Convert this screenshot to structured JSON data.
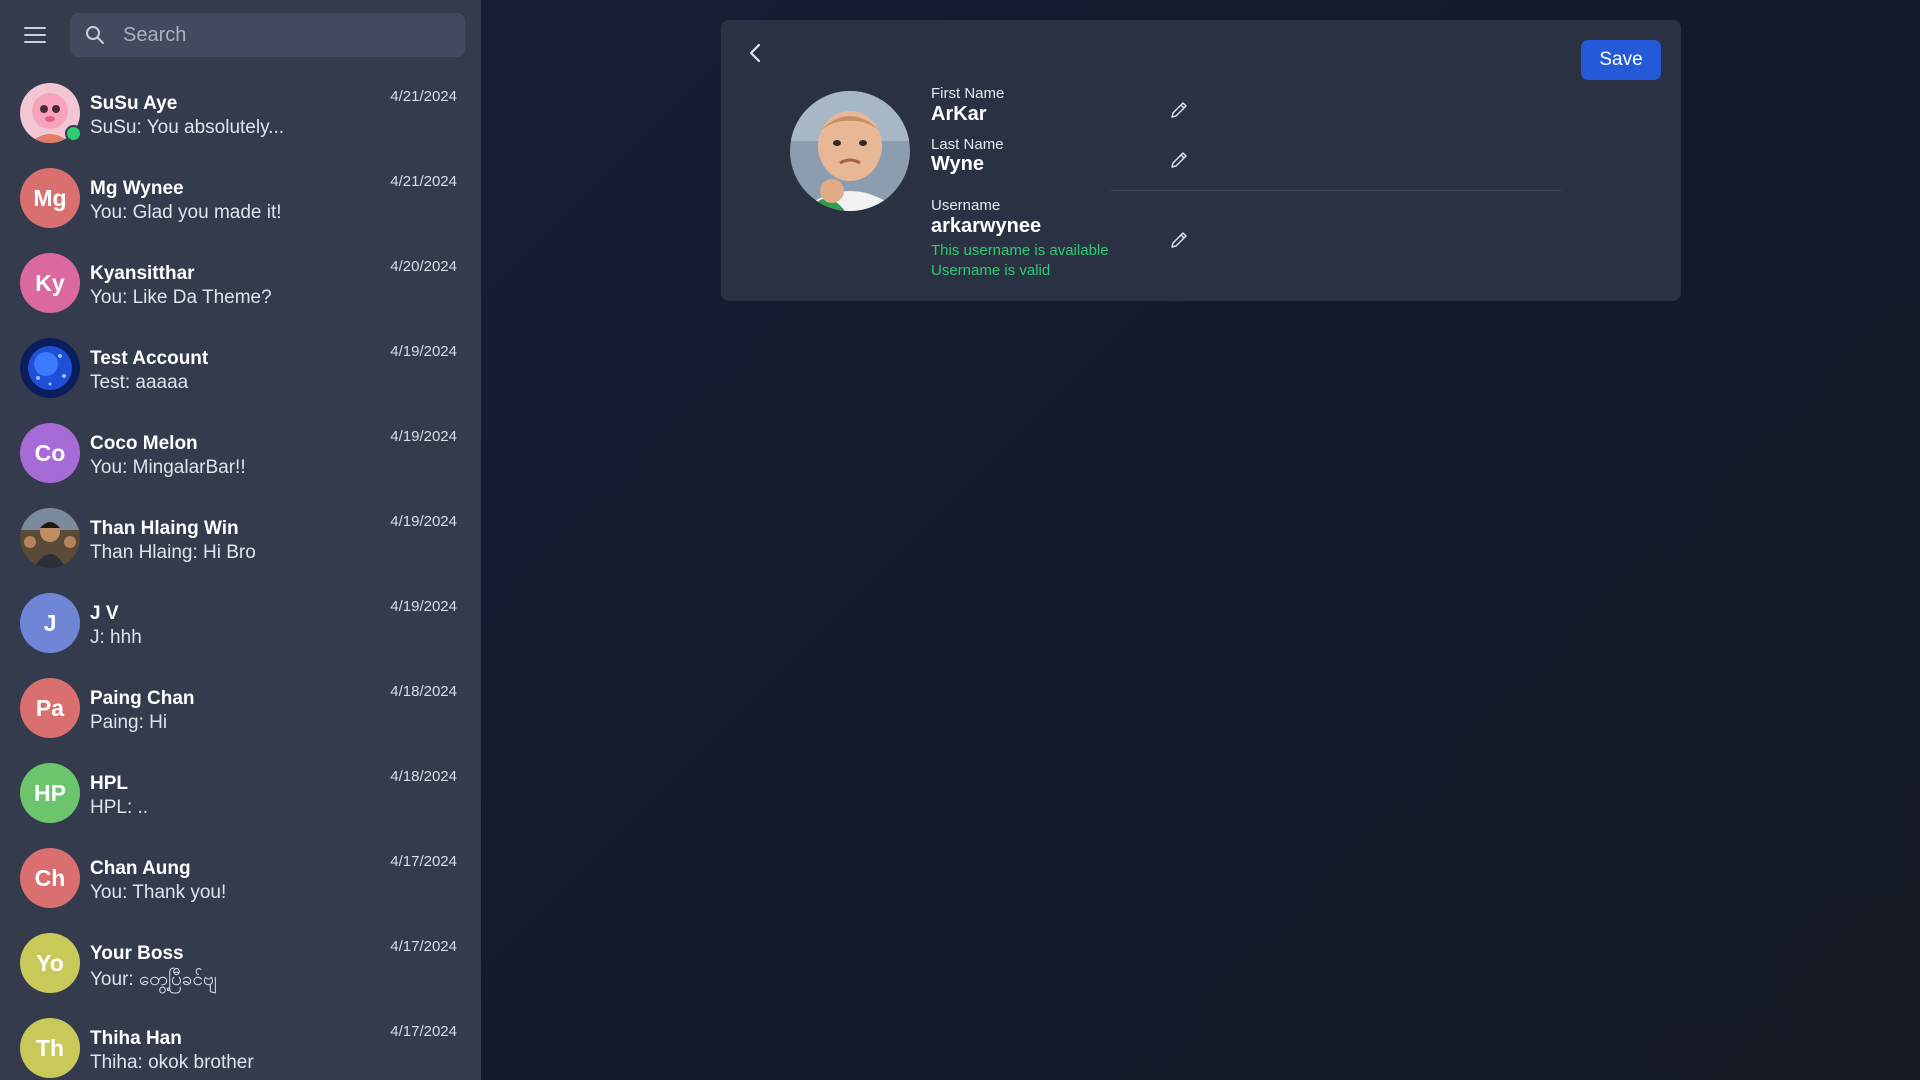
{
  "search": {
    "placeholder": "Search"
  },
  "chats": [
    {
      "name": "SuSu Aye",
      "message": "SuSu: You absolutely...",
      "date": "4/21/2024",
      "avatar": "photo-pink-character",
      "online": true
    },
    {
      "name": "Mg Wynee",
      "message": "You: Glad you made it!",
      "date": "4/21/2024",
      "initials": "Mg",
      "color": "#d9706f"
    },
    {
      "name": "Kyansitthar",
      "message": "You: Like Da Theme?",
      "date": "4/20/2024",
      "initials": "Ky",
      "color": "#d9699e"
    },
    {
      "name": "Test Account",
      "message": "Test: aaaaa",
      "date": "4/19/2024",
      "avatar": "photo-blue-abstract"
    },
    {
      "name": "Coco Melon",
      "message": "You: MingalarBar!!",
      "date": "4/19/2024",
      "initials": "Co",
      "color": "#a66bd6"
    },
    {
      "name": "Than Hlaing Win",
      "message": "Than Hlaing: Hi Bro",
      "date": "4/19/2024",
      "avatar": "photo-person"
    },
    {
      "name": "J V",
      "message": "J: hhh",
      "date": "4/19/2024",
      "initials": "J",
      "color": "#6f86d6"
    },
    {
      "name": "Paing Chan",
      "message": "Paing: Hi",
      "date": "4/18/2024",
      "initials": "Pa",
      "color": "#d9706f"
    },
    {
      "name": "HPL",
      "message": "HPL: ..",
      "date": "4/18/2024",
      "initials": "HP",
      "color": "#6cc46c"
    },
    {
      "name": "Chan Aung",
      "message": "You: Thank you!",
      "date": "4/17/2024",
      "initials": "Ch",
      "color": "#d9706f"
    },
    {
      "name": "Your Boss",
      "message": "Your: တွေ့ပြီခင်ဗျ",
      "date": "4/17/2024",
      "initials": "Yo",
      "color": "#c9c95a"
    },
    {
      "name": "Thiha Han",
      "message": "Thiha: okok brother",
      "date": "4/17/2024",
      "initials": "Th",
      "color": "#c9c95a"
    }
  ],
  "profile": {
    "save_label": "Save",
    "photo": "baby-success-photo",
    "first_name_label": "First Name",
    "first_name": "ArKar",
    "last_name_label": "Last Name",
    "last_name": "Wyne",
    "username_label": "Username",
    "username": "arkarwynee",
    "username_available": "This username is available",
    "username_valid": "Username is valid"
  },
  "colors": {
    "sidebar": "#333b4d",
    "panel": "#2a3142",
    "accent": "#2459d8",
    "success": "#2ecc71"
  },
  "icons": {
    "menu": "hamburger-icon",
    "search": "search-icon",
    "back": "chevron-left-icon",
    "edit": "pencil-icon"
  }
}
